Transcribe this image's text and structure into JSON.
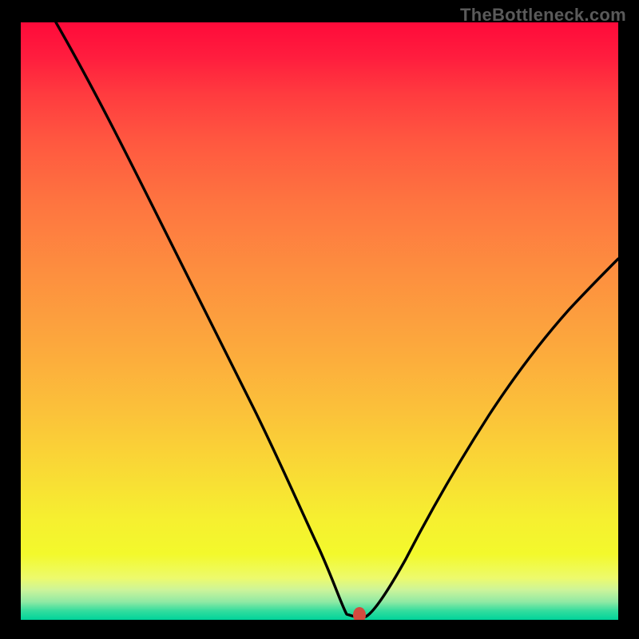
{
  "watermark": "TheBottleneck.com",
  "colors": {
    "background": "#000000",
    "gradient_top": "#ff0a3a",
    "gradient_bottom": "#00d39a",
    "curve": "#000000",
    "marker": "#d24b3f"
  },
  "chart_data": {
    "type": "line",
    "title": "",
    "xlabel": "",
    "ylabel": "",
    "xlim": [
      0,
      100
    ],
    "ylim": [
      0,
      100
    ],
    "series": [
      {
        "name": "bottleneck-curve",
        "x": [
          0,
          5,
          10,
          15,
          20,
          25,
          30,
          35,
          40,
          45,
          47,
          49,
          51,
          53,
          55,
          57,
          60,
          65,
          70,
          75,
          80,
          85,
          90,
          95,
          100
        ],
        "y": [
          100,
          92,
          83,
          74,
          65,
          56,
          47,
          38,
          29,
          19,
          13,
          7,
          2,
          0,
          0,
          2,
          6,
          14,
          22,
          30,
          38,
          45,
          51,
          57,
          62
        ]
      }
    ],
    "marker": {
      "x": 54,
      "y": 0
    },
    "background_gradient": {
      "top": "red",
      "middle": "yellow",
      "bottom": "green"
    }
  }
}
